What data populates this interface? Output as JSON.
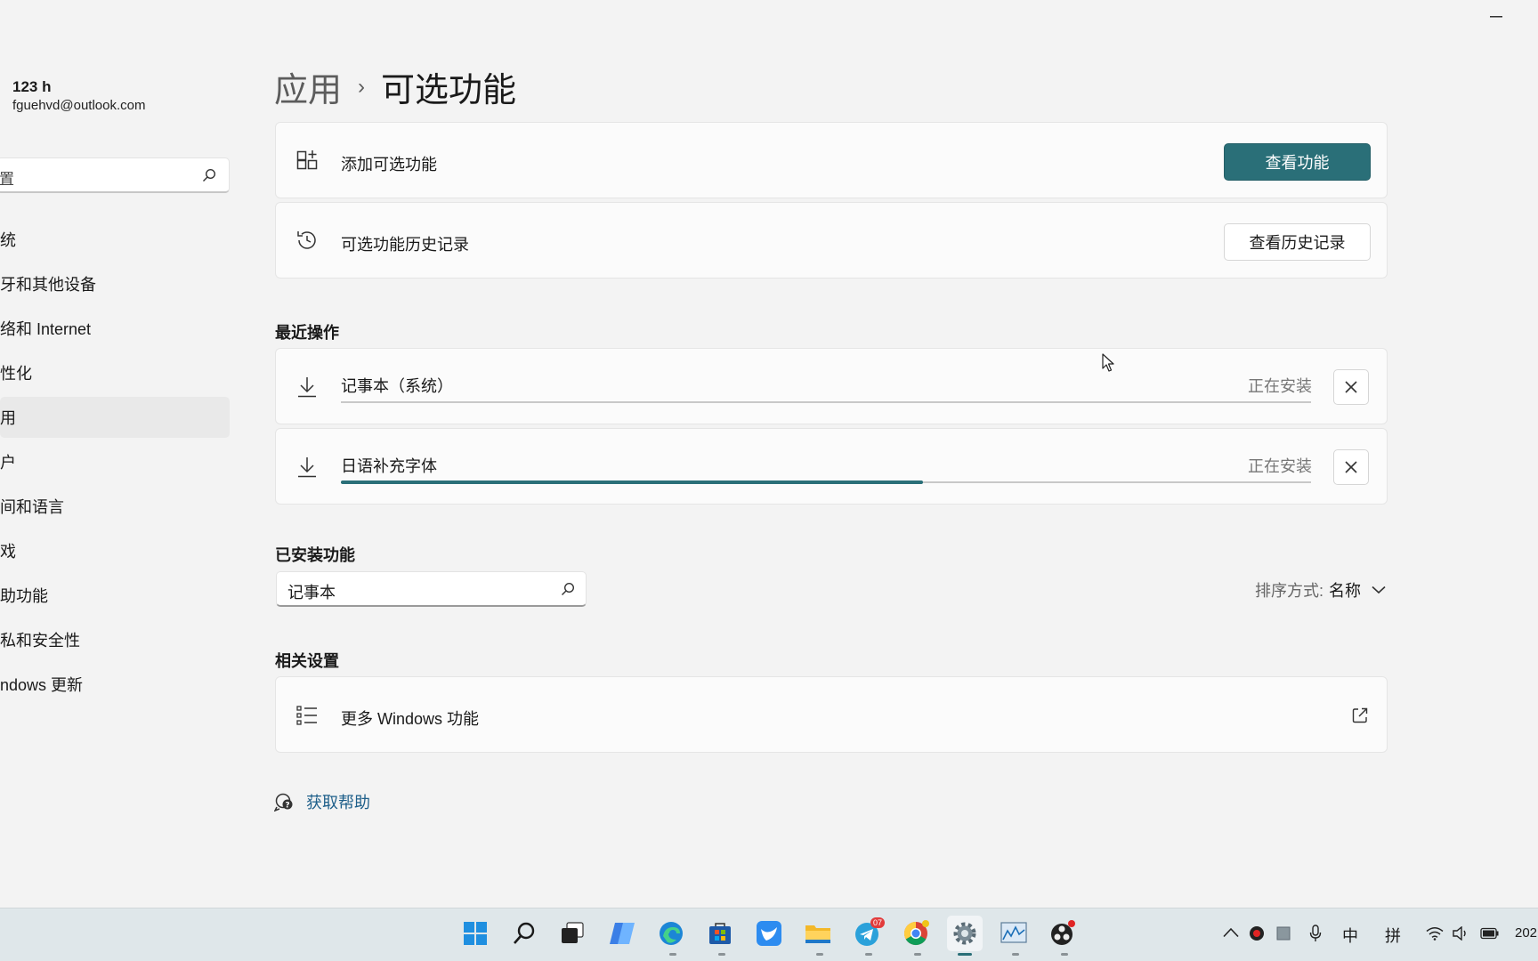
{
  "window": {
    "minimize_icon": "minimize-icon"
  },
  "sidebar": {
    "user_name": "123 h",
    "user_email": "fguehvd@outlook.com",
    "search_value": "置",
    "items": [
      {
        "label": "统"
      },
      {
        "label": "牙和其他设备"
      },
      {
        "label": "络和 Internet"
      },
      {
        "label": "性化"
      },
      {
        "label": "用",
        "selected": true
      },
      {
        "label": "户"
      },
      {
        "label": "间和语言"
      },
      {
        "label": "戏"
      },
      {
        "label": "助功能"
      },
      {
        "label": "私和安全性"
      },
      {
        "label": "ndows 更新"
      }
    ]
  },
  "breadcrumb": {
    "parent": "应用",
    "separator": "›",
    "current": "可选功能"
  },
  "add_feature": {
    "label": "添加可选功能",
    "button": "查看功能",
    "icon": "add-apps-icon"
  },
  "history": {
    "label": "可选功能历史记录",
    "button": "查看历史记录",
    "icon": "history-icon"
  },
  "recent": {
    "title": "最近操作",
    "items": [
      {
        "name": "记事本（系统）",
        "status": "正在安装",
        "progress": 0.0
      },
      {
        "name": "日语补充字体",
        "status": "正在安装",
        "progress": 0.6
      }
    ]
  },
  "installed": {
    "title": "已安装功能",
    "search_value": "记事本",
    "sort_label": "排序方式:",
    "sort_value": "名称"
  },
  "related": {
    "title": "相关设置",
    "item_label": "更多 Windows 功能"
  },
  "help": {
    "label": "获取帮助"
  },
  "taskbar": {
    "telegram_badge": "07",
    "clock_partial": "202"
  },
  "tray": {
    "ime_mode": "中",
    "ime_name": "拼"
  },
  "colors": {
    "accent": "#2a6f78",
    "background": "#f3f3f3",
    "card": "#fbfbfb",
    "taskbar": "#dfe7ea"
  }
}
